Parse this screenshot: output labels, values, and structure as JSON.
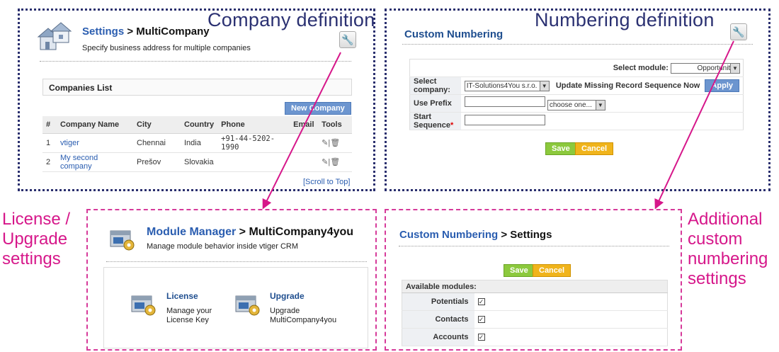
{
  "colors": {
    "navy": "#2a2f6e",
    "pink": "#d6178a",
    "link": "#2a5db0",
    "apply_blue": "#6c95cf",
    "save_green": "#8cc93d",
    "cancel_orange": "#f0b41c"
  },
  "captions": {
    "company_definition": "Company definition",
    "numbering_definition": "Numbering definition",
    "license_upgrade": [
      "License /",
      "Upgrade",
      "settings"
    ],
    "additional": [
      "Additional",
      "custom",
      "numbering",
      "settings"
    ]
  },
  "company_panel": {
    "icon": "houses-icon",
    "title_link": "Settings",
    "title_rest": " > MultiCompany",
    "subtitle": "Specify business address for multiple companies",
    "list_title": "Companies List",
    "new_button": "New Company",
    "columns": [
      "#",
      "Company Name",
      "City",
      "Country",
      "Phone",
      "Email",
      "Tools"
    ],
    "rows": [
      {
        "num": "1",
        "name": "vtiger",
        "city": "Chennai",
        "country": "India",
        "phone": "+91-44-5202-1990",
        "email": ""
      },
      {
        "num": "2",
        "name": "My second company",
        "city": "Prešov",
        "country": "Slovakia",
        "phone": "",
        "email": ""
      }
    ],
    "scroll_top": "[Scroll to Top]"
  },
  "numbering_panel": {
    "title": "Custom Numbering",
    "select_module_label": "Select module:",
    "module_value": "Opportunities",
    "select_company_label": "Select company:",
    "company_value": "IT-Solutions4You s.r.o.",
    "update_missing": "Update Missing Record Sequence Now",
    "apply": "Apply",
    "use_prefix": "Use Prefix",
    "choose_one": "choose one...",
    "start_sequence": "Start Sequence",
    "required_mark": "*",
    "save": "Save",
    "cancel": "Cancel"
  },
  "module_panel": {
    "icon": "module-manager-icon",
    "title_link": "Module Manager",
    "title_rest": " > MultiCompany4you",
    "subtitle": "Manage module behavior inside vtiger CRM",
    "license_title": "License",
    "license_desc": [
      "Manage your",
      "License Key"
    ],
    "upgrade_title": "Upgrade",
    "upgrade_desc": [
      "Upgrade",
      "MultiCompany4you"
    ]
  },
  "settings_panel": {
    "title_link": "Custom Numbering",
    "title_rest": " > Settings",
    "save": "Save",
    "cancel": "Cancel",
    "available_label": "Available modules:",
    "modules": [
      {
        "name": "Potentials",
        "checked": true
      },
      {
        "name": "Contacts",
        "checked": true
      },
      {
        "name": "Accounts",
        "checked": true
      }
    ]
  }
}
